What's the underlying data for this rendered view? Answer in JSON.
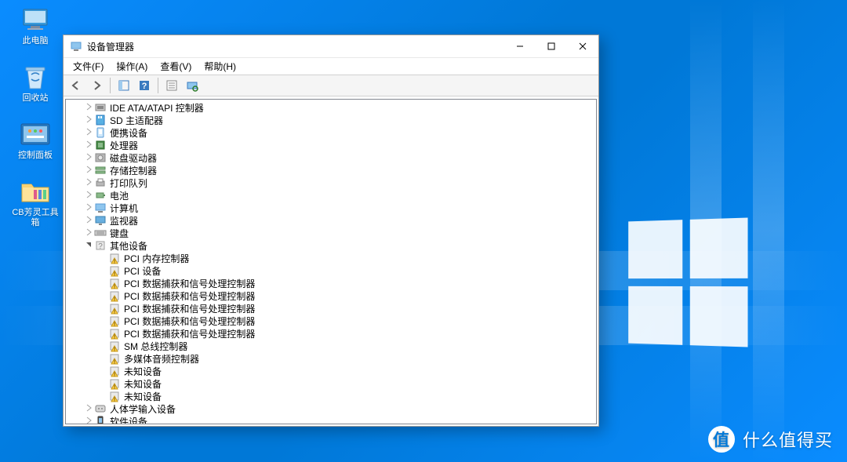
{
  "desktop": {
    "icons": [
      {
        "id": "this-pc",
        "label": "此电脑"
      },
      {
        "id": "recycle-bin",
        "label": "回收站"
      },
      {
        "id": "control-panel",
        "label": "控制面板"
      },
      {
        "id": "toolbox",
        "label": "CB芳灵工具箱"
      }
    ]
  },
  "window": {
    "title": "设备管理器",
    "menu": {
      "file": "文件(F)",
      "action": "操作(A)",
      "view": "查看(V)",
      "help": "帮助(H)"
    },
    "toolbar_icons": [
      "back",
      "forward",
      "sep",
      "show-hide-tree",
      "help",
      "sep",
      "properties",
      "scan-hardware"
    ],
    "tree": {
      "categories": [
        {
          "label": "IDE ATA/ATAPI 控制器",
          "icon": "ide",
          "expand": "closed"
        },
        {
          "label": "SD 主适配器",
          "icon": "sd",
          "expand": "closed"
        },
        {
          "label": "便携设备",
          "icon": "portable",
          "expand": "closed"
        },
        {
          "label": "处理器",
          "icon": "cpu",
          "expand": "closed"
        },
        {
          "label": "磁盘驱动器",
          "icon": "disk",
          "expand": "closed"
        },
        {
          "label": "存储控制器",
          "icon": "storage",
          "expand": "closed"
        },
        {
          "label": "打印队列",
          "icon": "printer",
          "expand": "closed"
        },
        {
          "label": "电池",
          "icon": "battery",
          "expand": "closed"
        },
        {
          "label": "计算机",
          "icon": "computer",
          "expand": "closed"
        },
        {
          "label": "监视器",
          "icon": "monitor",
          "expand": "closed"
        },
        {
          "label": "键盘",
          "icon": "keyboard",
          "expand": "closed"
        },
        {
          "label": "其他设备",
          "icon": "other",
          "expand": "open",
          "children": [
            {
              "label": "PCI 内存控制器"
            },
            {
              "label": "PCI 设备"
            },
            {
              "label": "PCI 数据捕获和信号处理控制器"
            },
            {
              "label": "PCI 数据捕获和信号处理控制器"
            },
            {
              "label": "PCI 数据捕获和信号处理控制器"
            },
            {
              "label": "PCI 数据捕获和信号处理控制器"
            },
            {
              "label": "PCI 数据捕获和信号处理控制器"
            },
            {
              "label": "SM 总线控制器"
            },
            {
              "label": "多媒体音频控制器"
            },
            {
              "label": "未知设备"
            },
            {
              "label": "未知设备"
            },
            {
              "label": "未知设备"
            }
          ]
        },
        {
          "label": "人体学输入设备",
          "icon": "hid",
          "expand": "closed"
        },
        {
          "label": "软件设备",
          "icon": "software",
          "expand": "closed"
        }
      ]
    }
  },
  "watermark": {
    "badge": "值",
    "text": "什么值得买"
  }
}
